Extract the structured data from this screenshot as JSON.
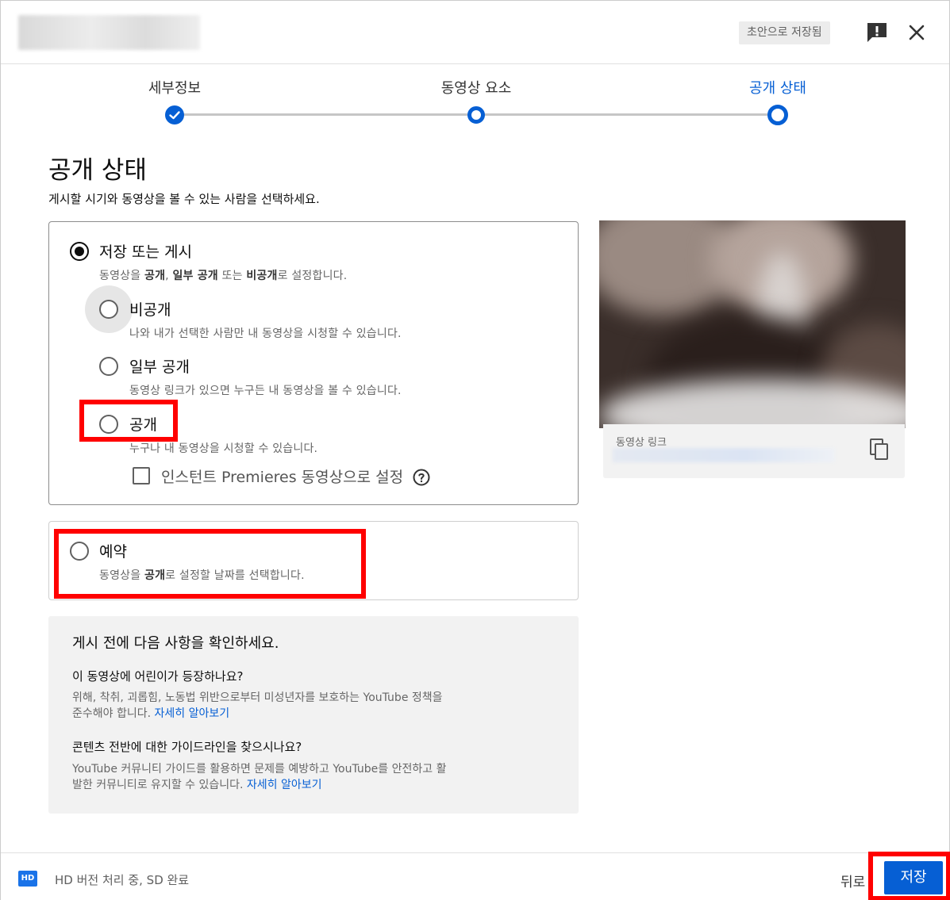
{
  "header": {
    "draft_status": "초안으로 저장됨",
    "icons": [
      "feedback-icon",
      "close-icon"
    ]
  },
  "stepper": {
    "steps": [
      {
        "label": "세부정보",
        "state": "done"
      },
      {
        "label": "동영상 요소",
        "state": "visited"
      },
      {
        "label": "공개 상태",
        "state": "current"
      }
    ]
  },
  "page": {
    "title": "공개 상태",
    "subtitle": "게시할 시기와 동영상을 볼 수 있는 사람을 선택하세요."
  },
  "visibility": {
    "save_or_publish": {
      "label": "저장 또는 게시",
      "desc_html_parts": [
        "동영상을 ",
        "공개",
        ", ",
        "일부 공개",
        " 또는 ",
        "비공개",
        "로 설정합니다."
      ],
      "selected": true
    },
    "options": [
      {
        "label": "비공개",
        "desc": "나와 내가 선택한 사람만 내 동영상을 시청할 수 있습니다.",
        "selected": false
      },
      {
        "label": "일부 공개",
        "desc": "동영상 링크가 있으면 누구든 내 동영상을 볼 수 있습니다.",
        "selected": false
      },
      {
        "label": "공개",
        "desc": "누구나 내 동영상을 시청할 수 있습니다.",
        "selected": false
      }
    ],
    "instant_premiere": {
      "label": "인스턴트 Premieres 동영상으로 설정",
      "checked": false
    }
  },
  "schedule": {
    "label": "예약",
    "desc_parts": [
      "동영상을 ",
      "공개",
      "로 설정할 날짜를 선택합니다."
    ],
    "selected": false
  },
  "checklist": {
    "title": "게시 전에 다음 사항을 확인하세요.",
    "q1": "이 동영상에 어린이가 등장하나요?",
    "a1_line1": "위해, 착취, 괴롭힘, 노동법 위반으로부터 미성년자를 보호하는 YouTube 정책을",
    "a1_line2": "준수해야 합니다. ",
    "a1_link": "자세히 알아보기",
    "q2": "콘텐츠 전반에 대한 가이드라인을 찾으시나요?",
    "a2_line1": "YouTube 커뮤니티 가이드를 활용하면 문제를 예방하고 YouTube를 안전하고 활",
    "a2_line2": "발한 커뮤니티로 유지할 수 있습니다. ",
    "a2_link": "자세히 알아보기"
  },
  "preview": {
    "link_label": "동영상 링크"
  },
  "footer": {
    "hd_badge": "HD",
    "status": "HD 버전 처리 중, SD 완료",
    "back_label": "뒤로",
    "save_label": "저장"
  },
  "colors": {
    "accent": "#065fd4",
    "highlight": "#ff0000"
  }
}
